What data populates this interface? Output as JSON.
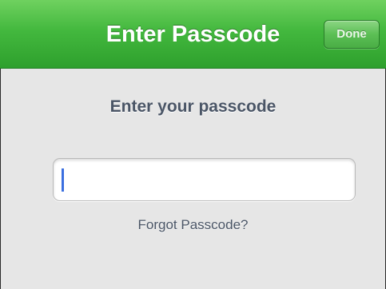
{
  "navbar": {
    "title": "Enter Passcode",
    "done_label": "Done"
  },
  "main": {
    "prompt": "Enter your passcode",
    "passcode_value": "",
    "forgot_label": "Forgot Passcode?"
  },
  "colors": {
    "navbar_green": "#43b83e",
    "text": "#4a5566",
    "cursor": "#3b6fe0"
  }
}
